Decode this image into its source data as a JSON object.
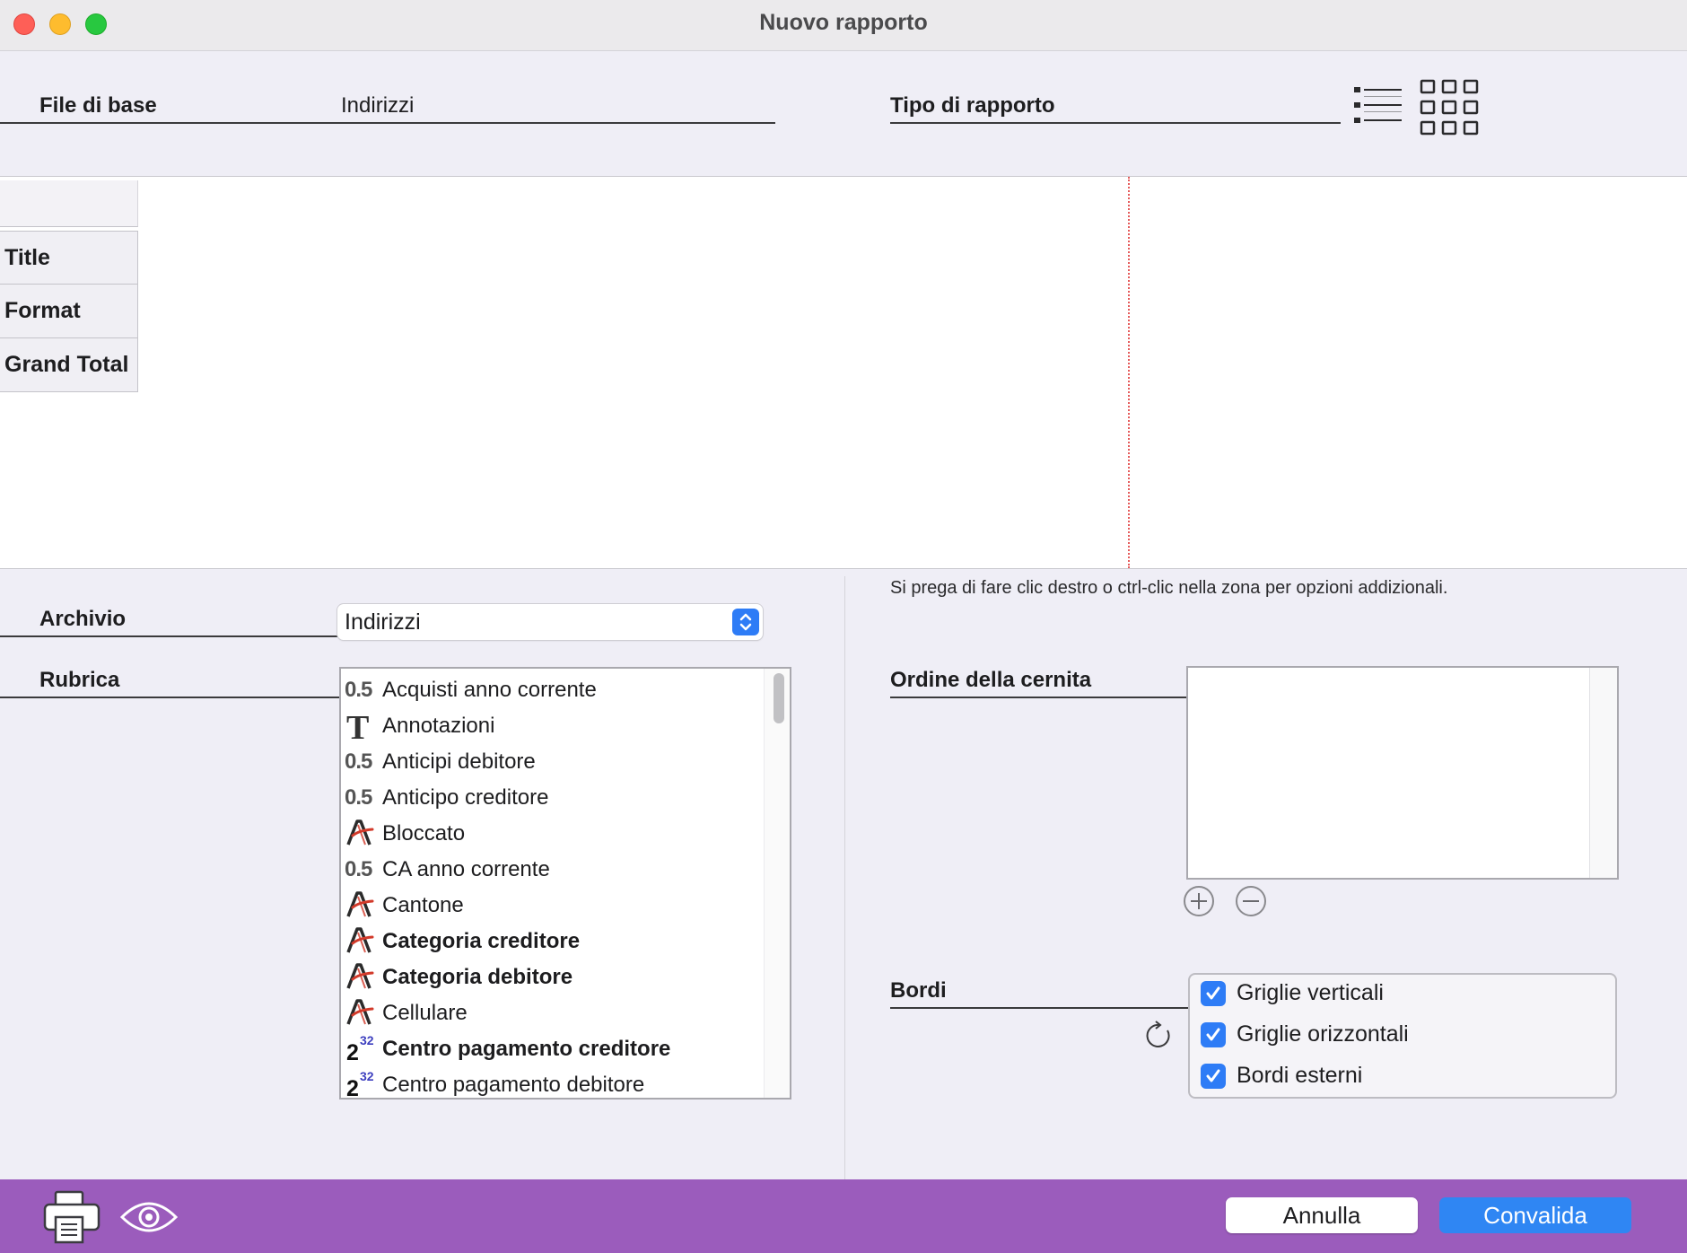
{
  "window": {
    "title": "Nuovo rapporto"
  },
  "header": {
    "base_file_label": "File di base",
    "base_file_value": "Indirizzi",
    "report_type_label": "Tipo di rapporto",
    "report_type_icons": [
      "list-report-icon",
      "grid-report-icon"
    ]
  },
  "layout": {
    "rows": [
      "Title",
      "Format",
      "Grand Total"
    ]
  },
  "hint": "Si prega di fare clic destro o ctrl-clic nella zona per opzioni addizionali.",
  "archive": {
    "label": "Archivio",
    "selected": "Indirizzi"
  },
  "fields": {
    "label": "Rubrica",
    "items": [
      {
        "label": "Acquisti anno corrente",
        "type": "number",
        "bold": false
      },
      {
        "label": "Annotazioni",
        "type": "text",
        "bold": false
      },
      {
        "label": "Anticipi debitore",
        "type": "number",
        "bold": false
      },
      {
        "label": "Anticipo creditore",
        "type": "number",
        "bold": false
      },
      {
        "label": "Bloccato",
        "type": "alpha",
        "bold": false
      },
      {
        "label": "CA anno corrente",
        "type": "number",
        "bold": false
      },
      {
        "label": "Cantone",
        "type": "alpha",
        "bold": false
      },
      {
        "label": "Categoria creditore",
        "type": "alpha",
        "bold": true
      },
      {
        "label": "Categoria debitore",
        "type": "alpha",
        "bold": true
      },
      {
        "label": "Cellulare",
        "type": "alpha",
        "bold": false
      },
      {
        "label": "Centro pagamento creditore",
        "type": "longint",
        "bold": true
      },
      {
        "label": "Centro pagamento debitore",
        "type": "longint",
        "bold": false
      }
    ],
    "type_glyphs": {
      "number": "0.5",
      "text": "T",
      "longint_base": "2",
      "longint_sup": "32"
    }
  },
  "sort": {
    "label": "Ordine della cernita",
    "items": []
  },
  "borders": {
    "label": "Bordi",
    "options": [
      {
        "label": "Griglie verticali",
        "checked": true
      },
      {
        "label": "Griglie orizzontali",
        "checked": true
      },
      {
        "label": "Bordi esterni",
        "checked": true
      }
    ]
  },
  "toolbar": {
    "cancel_label": "Annulla",
    "ok_label": "Convalida"
  },
  "colors": {
    "accent": "#2f86f3",
    "toolbar_bg": "#9b5cbc",
    "guide_line": "#e55b5b"
  }
}
